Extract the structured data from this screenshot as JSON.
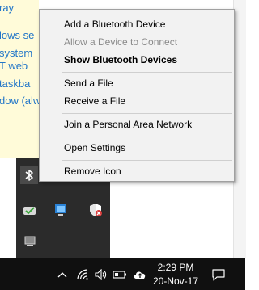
{
  "background_doc": {
    "lines": [
      "ray",
      "lows se",
      "system",
      "T web",
      "taskba",
      "dow (alw"
    ]
  },
  "context_menu": {
    "items": [
      {
        "label": "Add a Bluetooth Device",
        "state": "normal"
      },
      {
        "label": "Allow a Device to Connect",
        "state": "disabled"
      },
      {
        "label": "Show Bluetooth Devices",
        "state": "bold"
      },
      {
        "label": "Send a File",
        "state": "normal"
      },
      {
        "label": "Receive a File",
        "state": "normal"
      },
      {
        "label": "Join a Personal Area Network",
        "state": "normal"
      },
      {
        "label": "Open Settings",
        "state": "normal"
      },
      {
        "label": "Remove Icon",
        "state": "normal"
      }
    ]
  },
  "tray_overflow": {
    "icons": [
      "bluetooth-icon",
      "onedrive-sync-icon",
      "network-monitor-icon",
      "defender-security-icon",
      "display-icon"
    ]
  },
  "taskbar": {
    "clock": {
      "time": "2:29 PM",
      "date": "20-Nov-17"
    },
    "icons": [
      "chevron-up-icon",
      "wifi-icon",
      "volume-icon",
      "battery-icon",
      "cloud-upload-icon",
      "action-center-icon"
    ]
  },
  "colors": {
    "menu_background": "#f2f2f2",
    "taskbar_background": "#101010",
    "tray_background": "#2b2b2b",
    "note_background": "#fffbd9",
    "note_text": "#2276c8"
  }
}
